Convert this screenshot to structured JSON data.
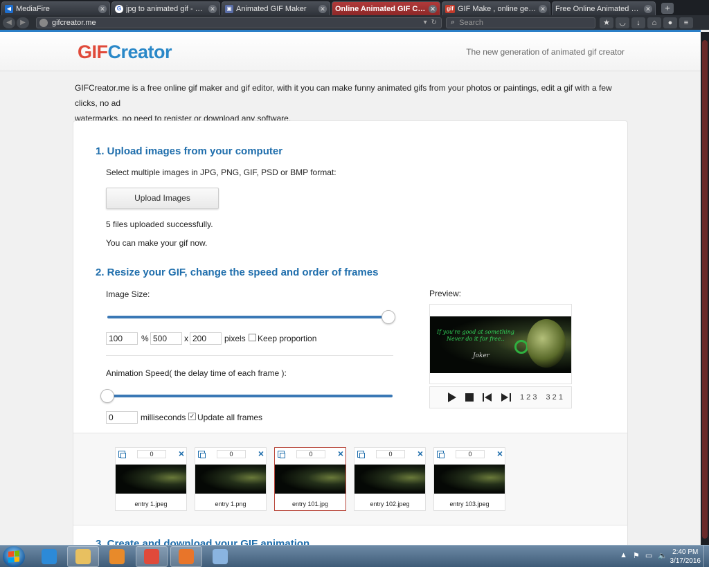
{
  "browser": {
    "tabs": [
      {
        "label": "MediaFire",
        "active": false,
        "favicon_color": "#1e6fd0"
      },
      {
        "label": "jpg to animated gif - Go...",
        "active": false,
        "favicon_color": "#ffffff"
      },
      {
        "label": "Animated GIF Maker",
        "active": false,
        "favicon_color": "#5a6ea8"
      },
      {
        "label": "Online Animated GIF Creat...",
        "active": true,
        "favicon_color": "#d0453a"
      },
      {
        "label": "GIF Make , online genera...",
        "active": false,
        "favicon_color": "#c23b2b"
      },
      {
        "label": "Free Online Animated GIF M...",
        "active": false,
        "favicon_color": "#3a3f46"
      }
    ],
    "url": "gifcreator.me",
    "search_placeholder": "Search"
  },
  "site": {
    "logo_part1": "GIF",
    "logo_part2": "Creator",
    "tagline": "The new generation of animated gif creator",
    "intro_line1": "GIFCreator.me is a free online gif maker and gif editor, with it you can make funny animated gifs from your photos or paintings, edit a gif with a few clicks, no ad",
    "intro_line2": "watermarks, no need to register or download any software."
  },
  "step1": {
    "heading": "1. Upload images from your computer",
    "instructions": "Select multiple images in JPG, PNG, GIF, PSD or BMP format:",
    "upload_button": "Upload Images",
    "status1": "5 files uploaded successfully.",
    "status2": "You can make your gif now."
  },
  "step2": {
    "heading": "2. Resize your GIF, change the speed and order of frames",
    "image_size_label": "Image Size:",
    "size_slider_percent": 100,
    "percent_value": "100",
    "percent_sign": "%",
    "width_value": "500",
    "x_sep": "x",
    "height_value": "200",
    "pixels_label": "pixels",
    "keep_proportion_label": "Keep proportion",
    "keep_proportion_checked": false,
    "speed_label": "Animation Speed( the delay time of each frame ):",
    "speed_slider_percent": 0,
    "delay_value": "0",
    "milliseconds_label": "milliseconds",
    "update_all_label": "Update all frames",
    "update_all_checked": true,
    "preview_label": "Preview:",
    "preview_image": {
      "caption_line1": "If you're good at something",
      "caption_line2": "Never do it for free..",
      "signature": "Joker"
    },
    "controls": {
      "order_asc": "1 2 3",
      "order_desc": "3 2 1"
    }
  },
  "frames": [
    {
      "name": "entry 1.jpeg",
      "delay": "0",
      "selected": false
    },
    {
      "name": "entry 1.png",
      "delay": "0",
      "selected": false
    },
    {
      "name": "entry 101.jpg",
      "delay": "0",
      "selected": true
    },
    {
      "name": "entry 102.jpeg",
      "delay": "0",
      "selected": false
    },
    {
      "name": "entry 103.jpeg",
      "delay": "0",
      "selected": false
    }
  ],
  "step3": {
    "heading": "3. Create and download your GIF animation"
  },
  "taskbar": {
    "apps": [
      {
        "name": "internet-explorer",
        "color": "#2c8ad8"
      },
      {
        "name": "file-explorer",
        "color": "#e8c060"
      },
      {
        "name": "media-player",
        "color": "#e88a2a"
      },
      {
        "name": "chrome",
        "color": "#e04a3a"
      },
      {
        "name": "firefox",
        "color": "#e8752a"
      },
      {
        "name": "paint",
        "color": "#8ab4e0"
      }
    ],
    "time": "2:40 PM",
    "date": "3/17/2016"
  }
}
